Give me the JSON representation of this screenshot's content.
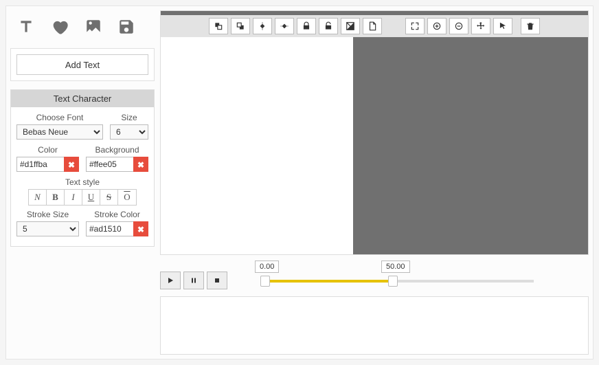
{
  "sidebar": {
    "add_text_label": "Add Text",
    "char_title": "Text Character",
    "font_label": "Choose Font",
    "font_value": "Bebas Neue",
    "size_label": "Size",
    "size_value": "6",
    "color_label": "Color",
    "color_value": "#d1ffba",
    "bg_label": "Background",
    "bg_value": "#ffee05",
    "style_label": "Text style",
    "stroke_size_label": "Stroke Size",
    "stroke_size_value": "5",
    "stroke_color_label": "Stroke Color",
    "stroke_color_value": "#ad1510"
  },
  "timeline": {
    "start": "0.00",
    "end": "50.00"
  }
}
